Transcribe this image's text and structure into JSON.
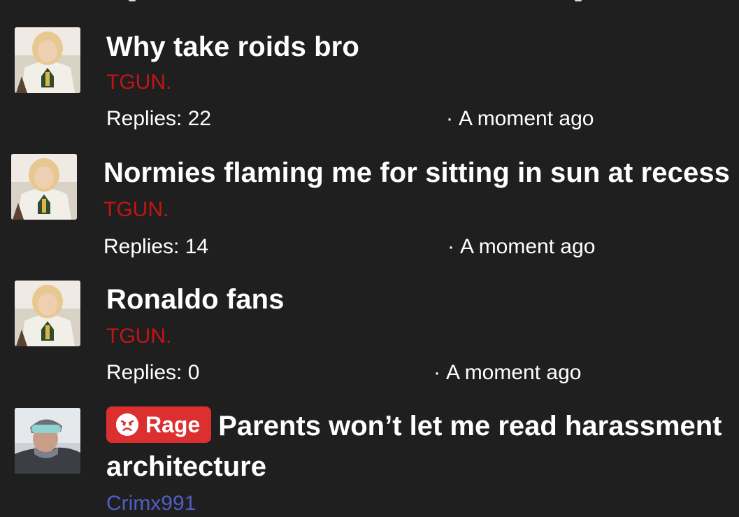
{
  "threads": [
    {
      "title": "Why take roids bro",
      "author": "TGUN.",
      "replies": "Replies: 22",
      "time": "A moment ago",
      "avatar": "blonde-woman-avatar",
      "author_color": "#c31414"
    },
    {
      "title": "Normies flaming me for sitting in sun at recess",
      "author": "TGUN.",
      "replies": "Replies: 14",
      "time": "A moment ago",
      "avatar": "blonde-woman-avatar",
      "author_color": "#c31414"
    },
    {
      "title": "Ronaldo fans",
      "author": "TGUN.",
      "replies": "Replies: 0",
      "time": "A moment ago",
      "avatar": "blonde-woman-avatar",
      "author_color": "#c31414"
    },
    {
      "badge": {
        "label": "Rage",
        "icon": "angry-face-icon",
        "color": "#dc2f2f"
      },
      "title": "Parents won’t let me read harassment architecture",
      "author": "Crimx991",
      "avatar": "skier-avatar",
      "author_color": "#4f5fc6"
    }
  ],
  "time_separator": "·",
  "colors": {
    "background": "#1f1f20",
    "text": "#ffffff"
  }
}
